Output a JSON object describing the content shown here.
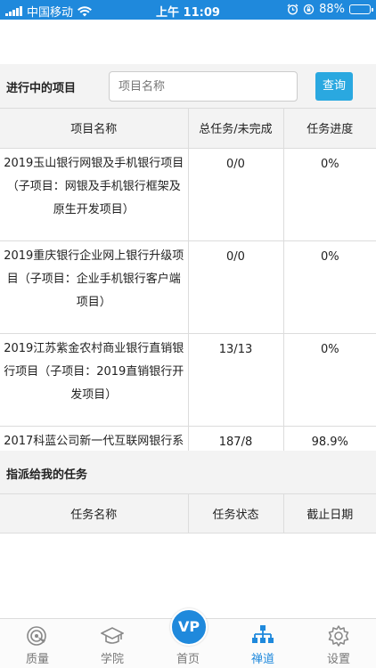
{
  "status_bar": {
    "carrier": "中国移动",
    "time": "上午 11:09",
    "battery": "88%",
    "battery_level": 0.88
  },
  "search": {
    "label": "进行中的项目",
    "placeholder": "项目名称",
    "button": "查询"
  },
  "projects_table": {
    "headers": [
      "项目名称",
      "总任务/未完成",
      "任务进度"
    ],
    "rows": [
      {
        "name": "2019玉山银行网银及手机银行项目（子项目：网银及手机银行框架及原生开发项目）",
        "tasks": "0/0",
        "progress": "0%"
      },
      {
        "name": "2019重庆银行企业网上银行升级项目（子项目：企业手机银行客户端项目）",
        "tasks": "0/0",
        "progress": "0%"
      },
      {
        "name": "2019江苏紫金农村商业银行直销银行项目（子项目：2019直销银行开发项目）",
        "tasks": "13/13",
        "progress": "0%"
      },
      {
        "name": "2017科蓝公司新一代互联网银行系",
        "tasks": "187/8",
        "progress": "98.9%"
      }
    ]
  },
  "assigned_section": {
    "title": "指派给我的任务",
    "headers": [
      "任务名称",
      "任务状态",
      "截止日期"
    ]
  },
  "tab_bar": {
    "items": [
      {
        "label": "质量",
        "icon": "target-icon"
      },
      {
        "label": "学院",
        "icon": "graduation-cap-icon"
      },
      {
        "label": "首页",
        "icon": "vp-logo-icon"
      },
      {
        "label": "禅道",
        "icon": "org-chart-icon"
      },
      {
        "label": "设置",
        "icon": "gear-icon"
      }
    ],
    "home_logo": "VP",
    "active_index": 3,
    "active_color": "#1f89dc"
  }
}
